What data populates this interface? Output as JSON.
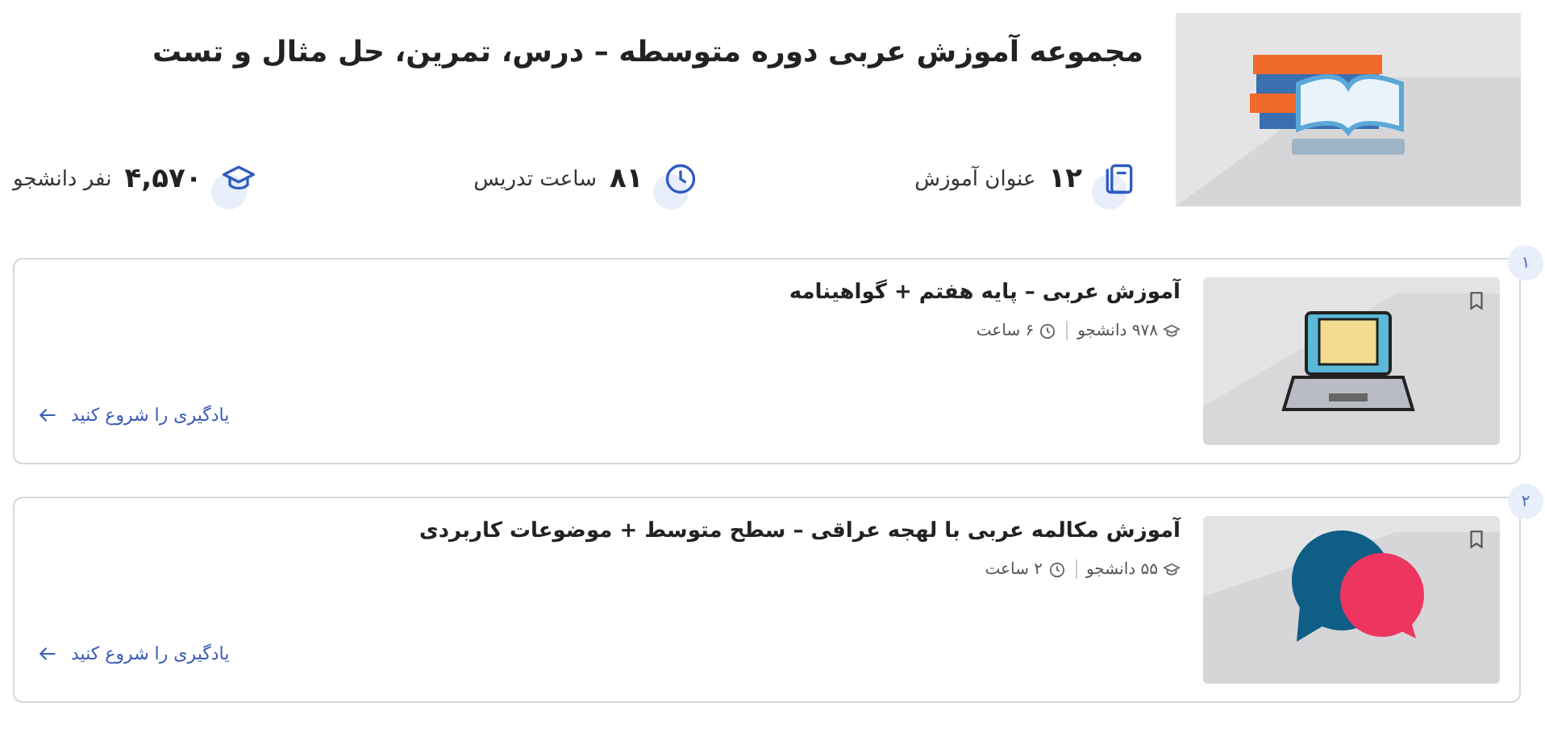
{
  "header": {
    "title": "مجموعه آموزش عربی دوره متوسطه – درس، تمرین، حل مثال و تست",
    "stats": [
      {
        "kind": "courses",
        "value": "۱۲",
        "label": "عنوان آموزش"
      },
      {
        "kind": "hours",
        "value": "۸۱",
        "label": "ساعت تدریس"
      },
      {
        "kind": "students",
        "value": "۴,۵۷۰",
        "label": "نفر دانشجو"
      }
    ]
  },
  "courses": [
    {
      "number": "۱",
      "title": "آموزش عربی – پایه هفتم + گواهینامه",
      "students": "۹۷۸ دانشجو",
      "duration": "۶ ساعت",
      "link": "یادگیری را شروع کنید"
    },
    {
      "number": "۲",
      "title": "آموزش مکالمه عربی با لهجه عراقی – سطح متوسط + موضوعات کاربردی",
      "students": "۵۵ دانشجو",
      "duration": "۲ ساعت",
      "link": "یادگیری را شروع کنید"
    }
  ]
}
